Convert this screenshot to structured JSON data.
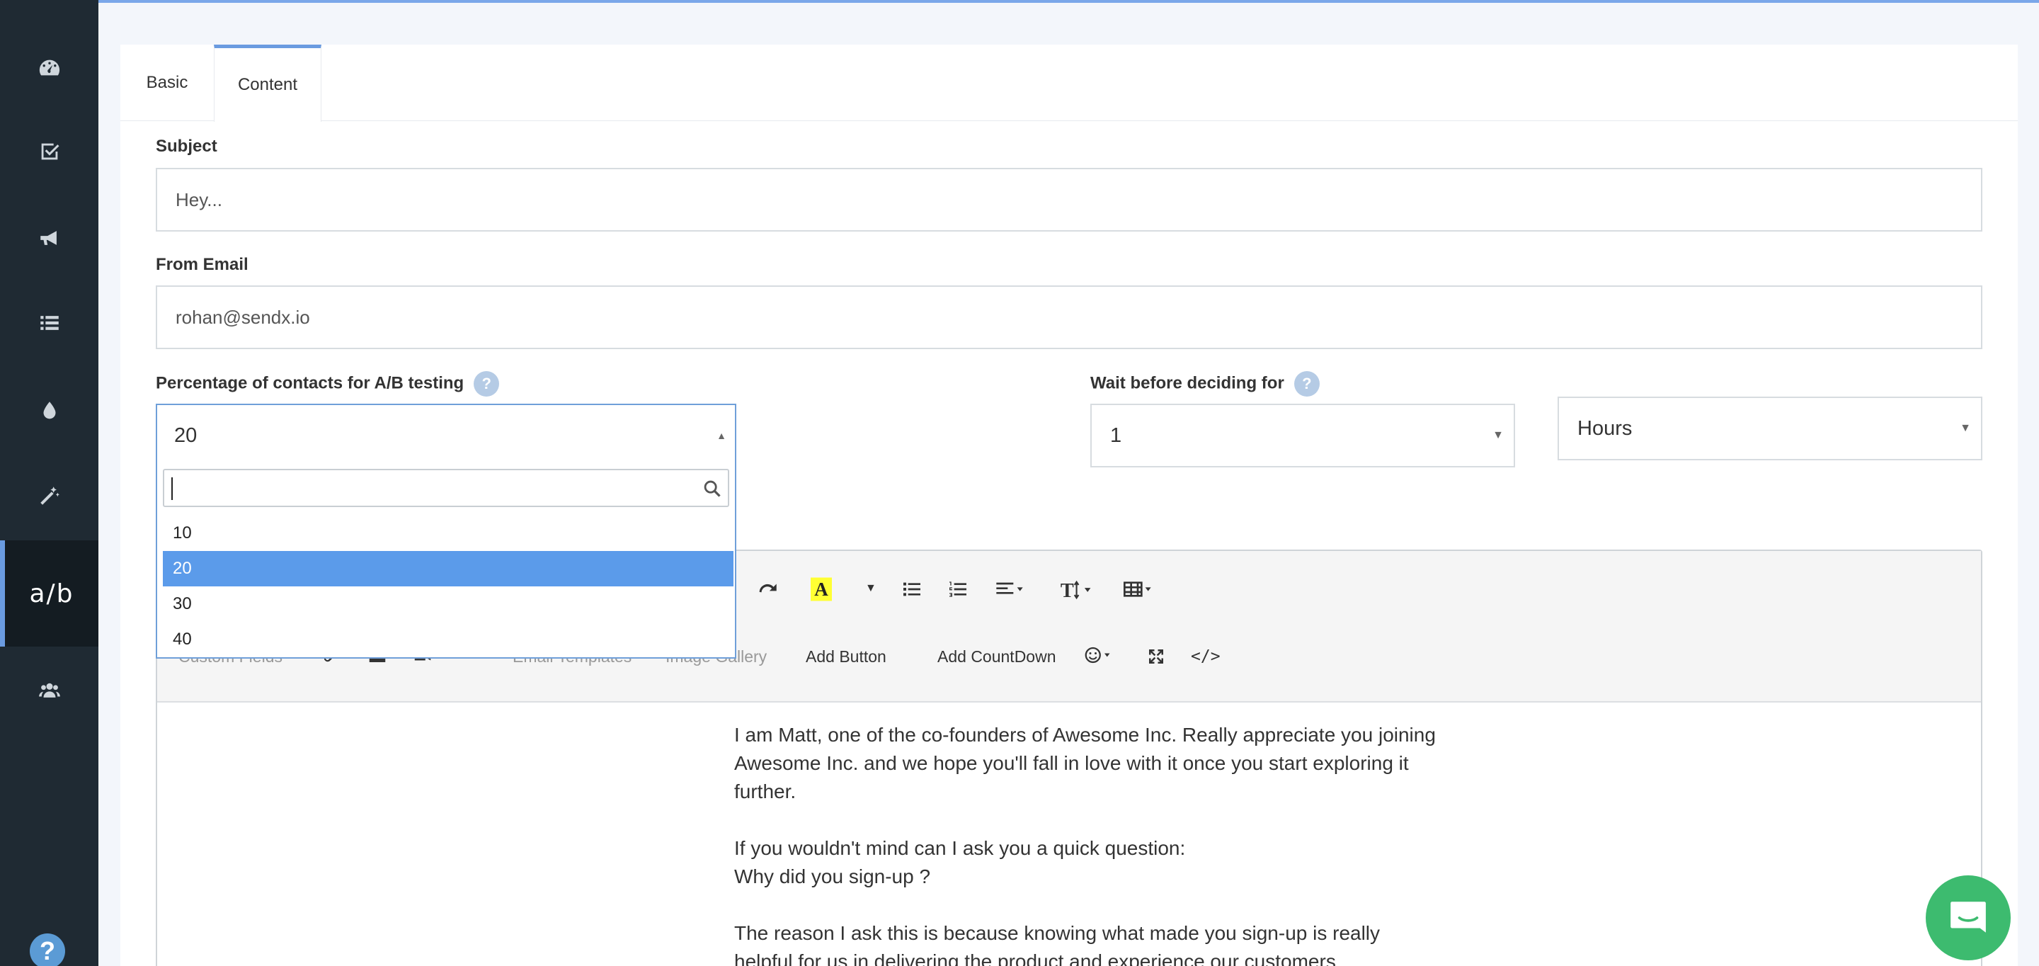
{
  "sidebar": {
    "items": [
      {
        "icon": "dashboard-icon"
      },
      {
        "icon": "checkbox-icon"
      },
      {
        "icon": "megaphone-icon"
      },
      {
        "icon": "list-icon"
      },
      {
        "icon": "drop-icon"
      },
      {
        "icon": "magic-wand-icon"
      },
      {
        "label": "a/b"
      },
      {
        "icon": "users-icon"
      }
    ],
    "help_label": "?"
  },
  "tabs": [
    {
      "label": "Basic"
    },
    {
      "label": "Content"
    }
  ],
  "form": {
    "subject_label": "Subject",
    "subject_value": "Hey...",
    "from_label": "From Email",
    "from_value": "rohan@sendx.io",
    "percentage_label": "Percentage of contacts for A/B testing",
    "percentage_value": "20",
    "wait_label": "Wait before deciding for",
    "wait_value": "1",
    "wait_unit": "Hours",
    "help_label": "?"
  },
  "dropdown": {
    "search_value": "",
    "options": [
      "10",
      "20",
      "30",
      "40"
    ],
    "selected": "20"
  },
  "editor": {
    "toolbar2": {
      "custom_fields": "Custom Fields",
      "email_templates": "Email Templates",
      "image_gallery": "Image Gallery",
      "add_button": "Add Button",
      "add_countdown": "Add CountDown",
      "code_view": "</>"
    },
    "paragraphs": [
      "I am Matt, one of the co-founders of Awesome Inc. Really appreciate you joining Awesome Inc. and we hope you'll fall in love with it once you start exploring it further.",
      "If you wouldn't mind can I ask you a quick question:\nWhy did you sign-up ?",
      "The reason I ask this is because knowing what made you sign-up is really helpful for us in delivering the product and experience our customers"
    ]
  },
  "colors": {
    "sidebar": "#1f2a33",
    "accent": "#6a9be0",
    "selected_option": "#5b9bea",
    "chat": "#3dbb6f"
  }
}
